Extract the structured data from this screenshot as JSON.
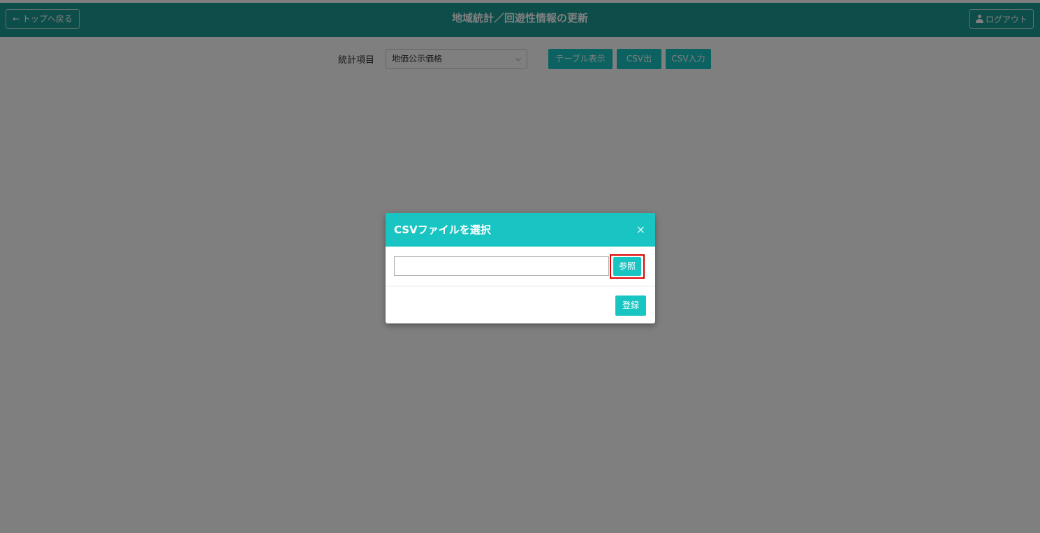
{
  "header": {
    "back_label": "← トップへ戻る",
    "title": "地域統計／回遊性情報の更新",
    "logout_label": "ログアウト"
  },
  "toolbar": {
    "stat_label": "統計項目",
    "stat_select_value": "地価公示価格",
    "table_button": "テーブル表示",
    "csv_out_button": "CSV出力",
    "csv_in_button": "CSV入力"
  },
  "modal": {
    "title": "CSVファイルを選択",
    "close": "×",
    "file_value": "",
    "browse_button": "参照",
    "register_button": "登録"
  },
  "colors": {
    "header_bg": "#1b9b95",
    "accent": "#19c5c2",
    "highlight": "#e00000"
  }
}
